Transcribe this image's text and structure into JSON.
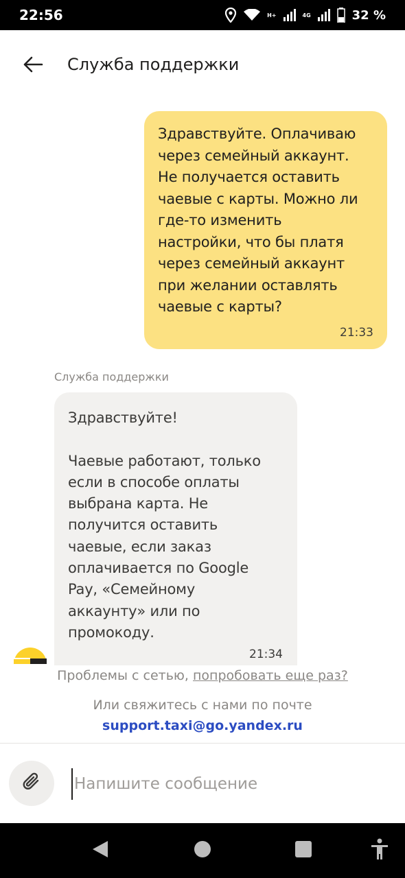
{
  "status_bar": {
    "time": "22:56",
    "network_label": "H+",
    "network_label_2": "4G",
    "battery": "32 %"
  },
  "header": {
    "title": "Служба поддержки",
    "back_icon": "arrow-left-icon"
  },
  "messages": [
    {
      "direction": "outgoing",
      "text": "Здравствуйте. Оплачиваю\nчерез семейный аккаунт.\nНе получается оставить\nчаевые с карты. Можно ли\nгде-то изменить\nнастройки, что бы платя\nчерез семейный аккаунт\nпри желании оставлять\nчаевые с карты?",
      "time": "21:33",
      "color": "#fce182"
    },
    {
      "direction": "incoming",
      "sender": "Служба поддержки",
      "text": "Здравствуйте!\n\nЧаевые работают, только\nесли в способе оплаты\nвыбрана карта. Не\nполучится оставить\nчаевые, если заказ\nоплачивается по Google\nPay, «Семейному\nаккаунту» или по\nпромокоду.",
      "time": "21:34",
      "color": "#f2f1ef"
    }
  ],
  "notices": {
    "network_problem": "Проблемы с сетью,",
    "retry_link": "попробовать еще раз?",
    "contact_mail": "Или свяжитесь с нами по почте",
    "email": "support.taxi@go.yandex.ru"
  },
  "composer": {
    "placeholder": "Напишите сообщение",
    "value": "",
    "attach_icon": "paperclip-icon"
  },
  "nav_bar": {
    "back_icon": "nav-back-icon",
    "home_icon": "nav-home-icon",
    "recents_icon": "nav-recents-icon",
    "accessibility_icon": "accessibility-icon"
  },
  "colors": {
    "accent_yellow": "#fce182",
    "link_blue": "#2b4cc2"
  }
}
